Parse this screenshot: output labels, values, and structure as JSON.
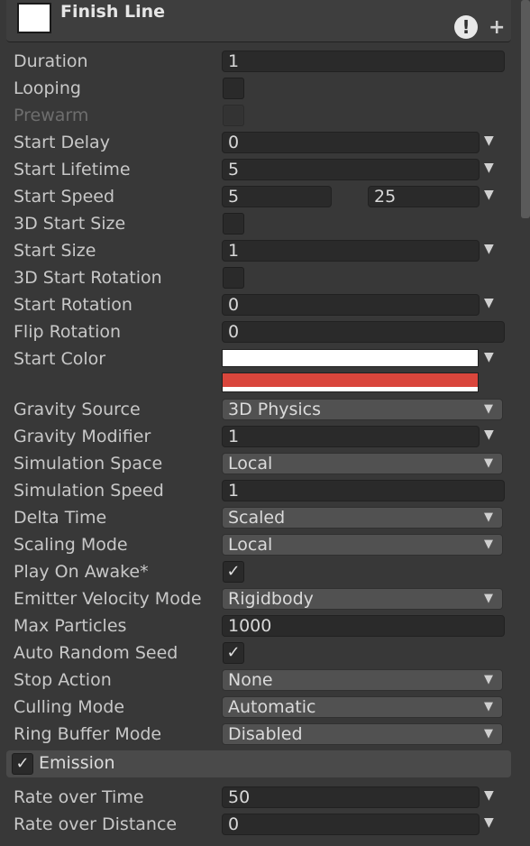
{
  "header": {
    "title": "Finish Line",
    "warning_glyph": "!",
    "add_glyph": "+"
  },
  "fields": {
    "duration": {
      "label": "Duration",
      "value": "1"
    },
    "looping": {
      "label": "Looping",
      "checked": false
    },
    "prewarm": {
      "label": "Prewarm",
      "checked": false,
      "disabled": true
    },
    "start_delay": {
      "label": "Start Delay",
      "value": "0"
    },
    "start_lifetime": {
      "label": "Start Lifetime",
      "value": "5"
    },
    "start_speed": {
      "label": "Start Speed",
      "min": "5",
      "max": "25"
    },
    "start_size_3d": {
      "label": "3D Start Size",
      "checked": false
    },
    "start_size": {
      "label": "Start Size",
      "value": "1"
    },
    "start_rotation_3d": {
      "label": "3D Start Rotation",
      "checked": false
    },
    "start_rotation": {
      "label": "Start Rotation",
      "value": "0"
    },
    "flip_rotation": {
      "label": "Flip Rotation",
      "value": "0"
    },
    "start_color": {
      "label": "Start Color",
      "color_a": "#ffffff",
      "color_b": "#d9463c"
    },
    "gravity_source": {
      "label": "Gravity Source",
      "value": "3D Physics"
    },
    "gravity_modifier": {
      "label": "Gravity Modifier",
      "value": "1"
    },
    "simulation_space": {
      "label": "Simulation Space",
      "value": "Local"
    },
    "simulation_speed": {
      "label": "Simulation Speed",
      "value": "1"
    },
    "delta_time": {
      "label": "Delta Time",
      "value": "Scaled"
    },
    "scaling_mode": {
      "label": "Scaling Mode",
      "value": "Local"
    },
    "play_on_awake": {
      "label": "Play On Awake*",
      "checked": true
    },
    "emitter_velocity_mode": {
      "label": "Emitter Velocity Mode",
      "value": "Rigidbody"
    },
    "max_particles": {
      "label": "Max Particles",
      "value": "1000"
    },
    "auto_random_seed": {
      "label": "Auto Random Seed",
      "checked": true
    },
    "stop_action": {
      "label": "Stop Action",
      "value": "None"
    },
    "culling_mode": {
      "label": "Culling Mode",
      "value": "Automatic"
    },
    "ring_buffer_mode": {
      "label": "Ring Buffer Mode",
      "value": "Disabled"
    }
  },
  "emission": {
    "title": "Emission",
    "enabled": true,
    "rate_over_time": {
      "label": "Rate over Time",
      "value": "50"
    },
    "rate_over_distance": {
      "label": "Rate over Distance",
      "value": "0"
    }
  },
  "glyphs": {
    "check": "✓",
    "chevron": "▼"
  }
}
